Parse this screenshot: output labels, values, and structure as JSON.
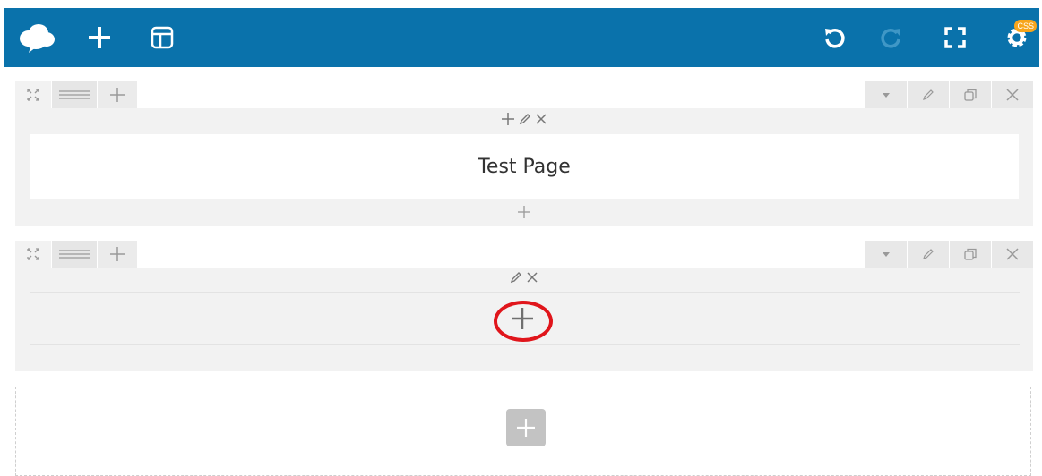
{
  "toolbar": {
    "background": "#0a72ab",
    "icons": [
      "logo-cloud-icon",
      "plus-icon",
      "layout-icon",
      "undo-icon",
      "redo-icon",
      "fullscreen-icon",
      "gear-icon"
    ],
    "css_badge": "CSS"
  },
  "rows": [
    {
      "module": {
        "title": "Test Page"
      }
    },
    {
      "module": null
    }
  ],
  "colors": {
    "row_bg": "#f2f2f2",
    "annotation": "#e0151b",
    "badge": "#f7a51c"
  }
}
